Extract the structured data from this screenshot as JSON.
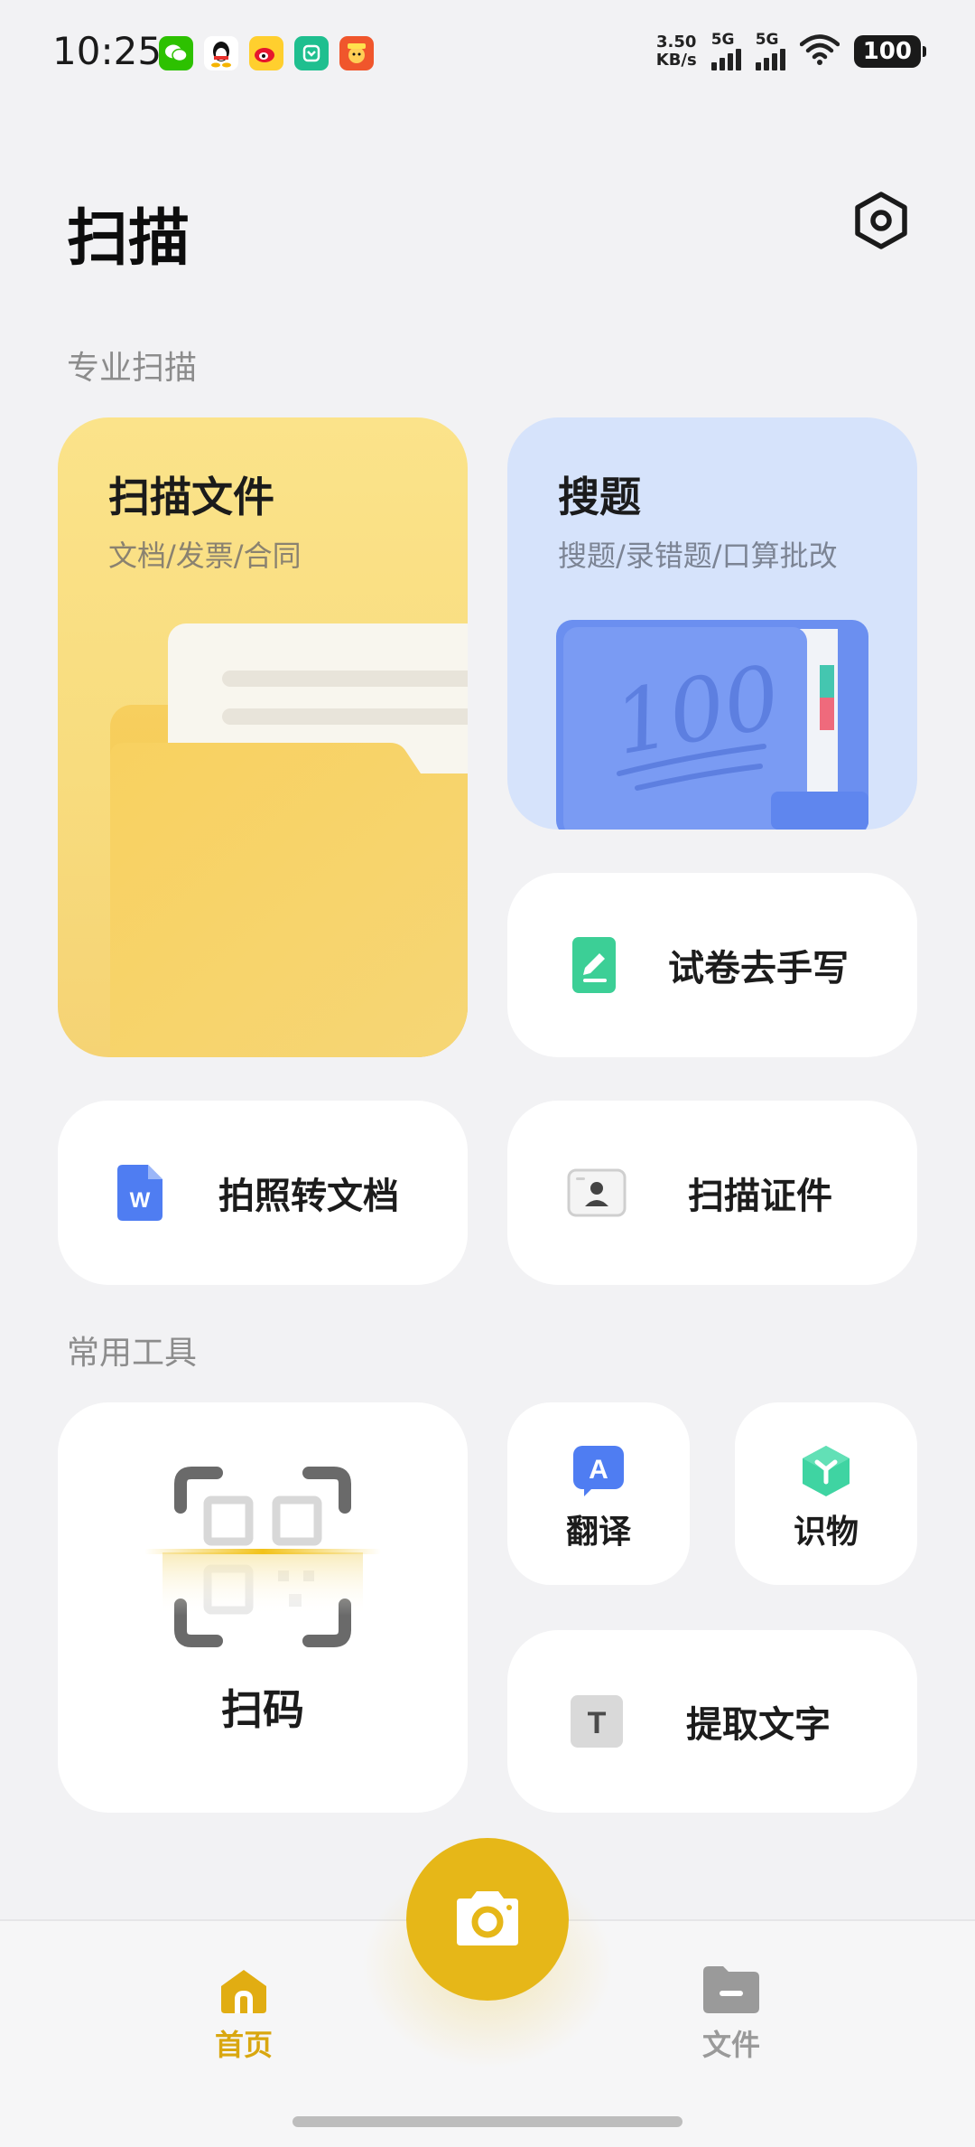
{
  "status_bar": {
    "time": "10:25",
    "speed_value": "3.50",
    "speed_unit": "KB/s",
    "sim1_label": "5G",
    "sim2_label": "5G",
    "battery": "100",
    "notification_icons": [
      "wechat-icon",
      "qq-icon",
      "weibo-icon",
      "app-icon",
      "game-icon"
    ]
  },
  "header": {
    "title": "扫描",
    "settings_icon": "settings-hexagon-icon"
  },
  "sections": {
    "pro": "专业扫描",
    "tools": "常用工具"
  },
  "pro_scan": {
    "scan_file": {
      "title": "扫描文件",
      "subtitle": "文档/发票/合同"
    },
    "search_question": {
      "title": "搜题",
      "subtitle": "搜题/录错题/口算批改"
    },
    "remove_handwriting": {
      "label": "试卷去手写",
      "icon": "pen-edit-icon"
    },
    "photo_to_doc": {
      "label": "拍照转文档",
      "icon": "word-doc-icon"
    },
    "scan_id": {
      "label": "扫描证件",
      "icon": "id-card-icon"
    }
  },
  "tools": {
    "scan_code": {
      "label": "扫码",
      "icon": "qr-scan-icon"
    },
    "translate": {
      "label": "翻译",
      "icon": "translate-icon"
    },
    "identify": {
      "label": "识物",
      "icon": "identify-cube-icon"
    },
    "extract_text": {
      "label": "提取文字",
      "icon": "text-t-icon"
    }
  },
  "bottom_nav": {
    "home": "首页",
    "files": "文件",
    "camera_icon": "camera-icon"
  },
  "colors": {
    "accent": "#e6b718",
    "nav_active": "#d9a70f",
    "nav_inactive": "#9a9a9a",
    "background": "#f2f2f4"
  }
}
